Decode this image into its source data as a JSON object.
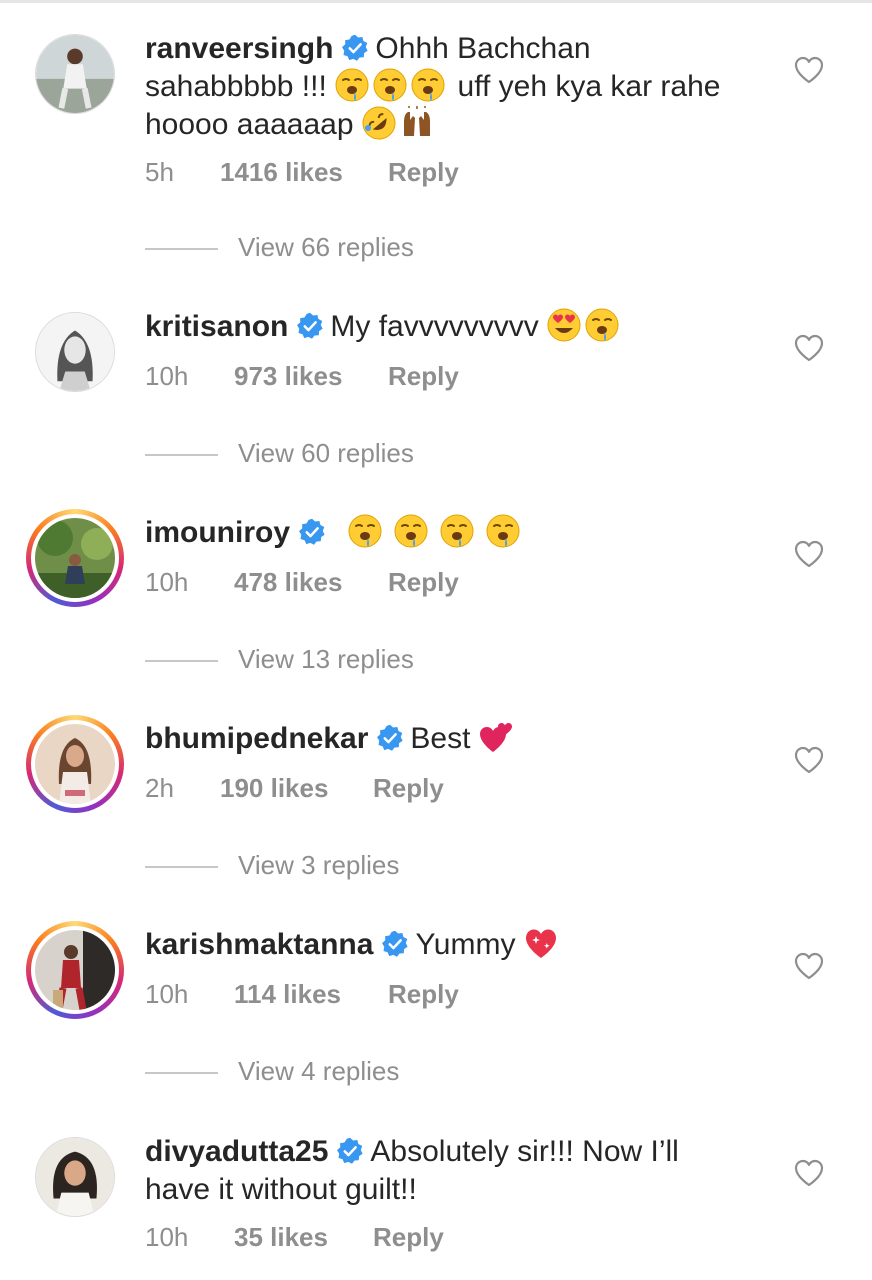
{
  "colors": {
    "text": "#262626",
    "secondary": "#8e8e8e",
    "verified": "#3897f0",
    "divider": "#c7c7c7"
  },
  "comments": [
    {
      "username": "ranveersingh",
      "text_pre": "Ohhh Bachchan",
      "text_line2_a": "sahabbbbb !!!",
      "text_line2_b": "uff yeh kya kar rahe",
      "text_line3": "hoooo aaaaaap",
      "time": "5h",
      "likes": "1416 likes",
      "reply": "Reply",
      "view_replies": "View 66 replies",
      "emojis": [
        "drooling-face",
        "drooling-face",
        "drooling-face",
        "rolling-laughing-face",
        "raising-hands-dark"
      ]
    },
    {
      "username": "kritisanon",
      "text": "My favvvvvvvvv",
      "time": "10h",
      "likes": "973 likes",
      "reply": "Reply",
      "view_replies": "View 60 replies",
      "emojis": [
        "heart-eyes-face",
        "drooling-face"
      ]
    },
    {
      "username": "imouniroy",
      "text": "",
      "time": "10h",
      "likes": "478 likes",
      "reply": "Reply",
      "view_replies": "View 13 replies",
      "emojis": [
        "drooling-face",
        "drooling-face",
        "drooling-face",
        "drooling-face"
      ]
    },
    {
      "username": "bhumipednekar",
      "text": "Best",
      "time": "2h",
      "likes": "190 likes",
      "reply": "Reply",
      "view_replies": "View 3 replies",
      "emojis": [
        "two-hearts"
      ]
    },
    {
      "username": "karishmaktanna",
      "text": "Yummy",
      "time": "10h",
      "likes": "114 likes",
      "reply": "Reply",
      "view_replies": "View 4 replies",
      "emojis": [
        "sparkling-heart"
      ]
    },
    {
      "username": "divyadutta25",
      "text": "Absolutely sir!!! Now I’ll",
      "text_line2": "have it without guilt!!",
      "time": "10h",
      "likes": "35 likes",
      "reply": "Reply"
    }
  ]
}
